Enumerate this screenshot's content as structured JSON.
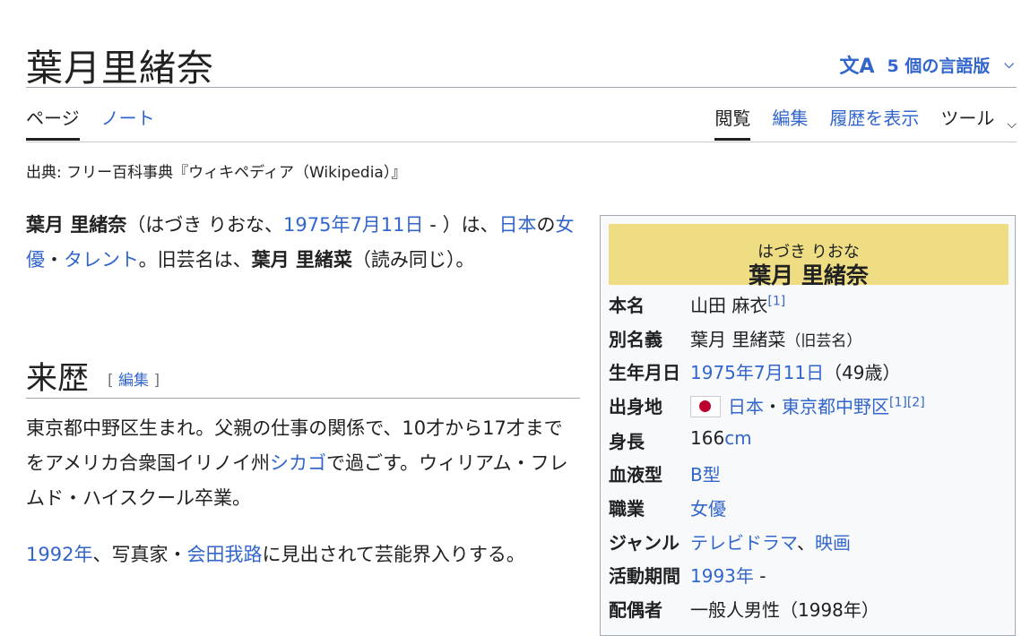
{
  "page": {
    "title": "葉月里緒奈",
    "language_button": "5 個の言語版",
    "language_icon": "文A",
    "tabs_left": [
      "ページ",
      "ノート"
    ],
    "tabs_right": [
      "閲覧",
      "編集",
      "履歴を表示",
      "ツール"
    ],
    "source": "出典: フリー百科事典『ウィキペディア（Wikipedia）』"
  },
  "intro": {
    "name_bold": "葉月 里緒奈",
    "ruby": "（はづき りおな、",
    "birth_link": "1975年7月11日",
    "after_birth": " - ）は、",
    "nihon_link": "日本",
    "no": "の",
    "actress_link": "女優",
    "dot": "・",
    "talent_link": "タレント",
    "old_name_text": "。旧芸名は、",
    "old_name_bold": "葉月 里緒菜",
    "end": "（読み同じ）。"
  },
  "history": {
    "heading": "来歴",
    "edit_open": "[ ",
    "edit_label": "編集",
    "edit_close": " ]",
    "p2_a": "東京都中野区生まれ。父親の仕事の関係で、10才から17才までをアメリカ合衆国イリノイ州",
    "p2_link": "シカゴ",
    "p2_b": "で過ごす。ウィリアム・フレムド・ハイスクール卒業。",
    "p3_link1": "1992年",
    "p3_a": "、写真家・",
    "p3_link2": "会田我路",
    "p3_b": "に見出されて芸能界入りする。"
  },
  "infobox": {
    "ruby": "はづき りおな",
    "name": "葉月 里緒奈",
    "rows": {
      "real_name": {
        "key": "本名",
        "value": "山田 麻衣",
        "ref": "[1]"
      },
      "alias": {
        "key": "別名義",
        "value": "葉月 里緒菜",
        "note": "（旧芸名）"
      },
      "birth": {
        "key": "生年月日",
        "link": "1975年7月11日",
        "note": "（49歳）"
      },
      "origin": {
        "key": "出身地",
        "link1": "日本",
        "dot": "・",
        "link2": "東京都中野区",
        "ref": "[1][2]"
      },
      "height": {
        "key": "身長",
        "value": "166",
        "unit_link": "cm"
      },
      "blood": {
        "key": "血液型",
        "link": "B型"
      },
      "job": {
        "key": "職業",
        "link": "女優"
      },
      "genre": {
        "key": "ジャンル",
        "link1": "テレビドラマ",
        "sep": "、",
        "link2": "映画"
      },
      "active": {
        "key": "活動期間",
        "link": "1993年",
        "suffix": " -"
      },
      "spouse": {
        "key": "配偶者",
        "value": "一般人男性（1998年）"
      }
    }
  }
}
